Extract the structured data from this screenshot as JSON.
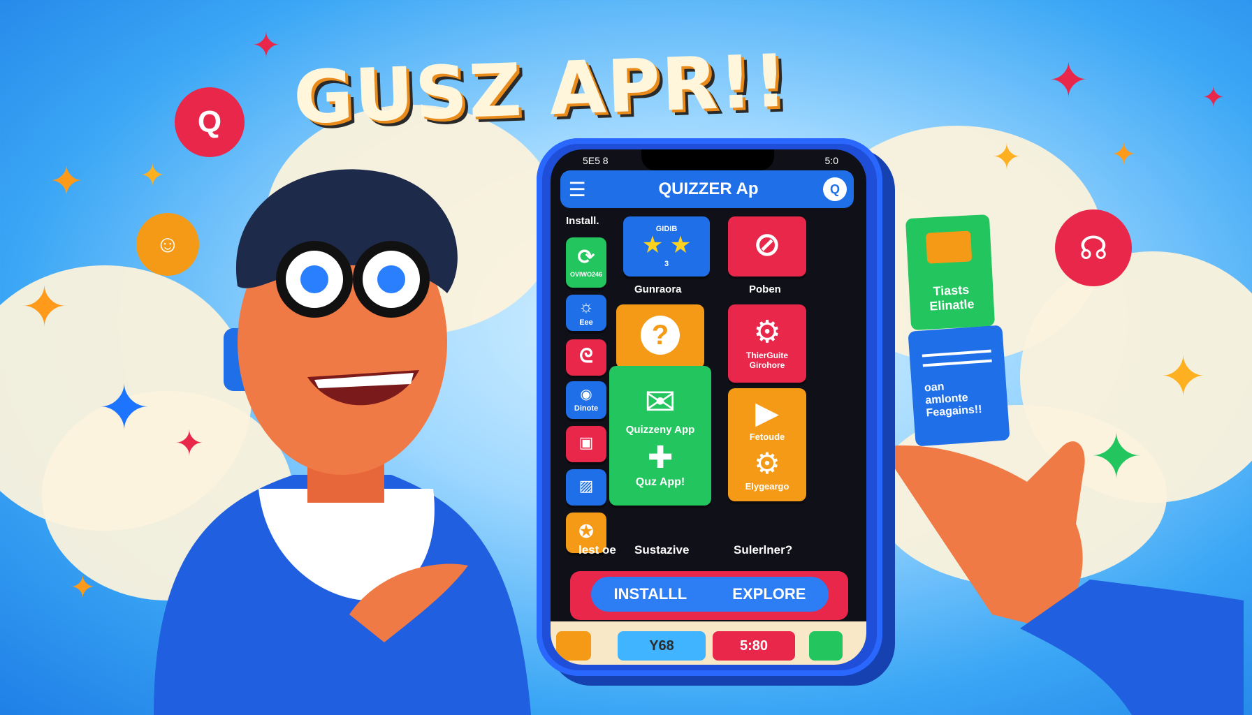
{
  "headline": "GUSZ APR!!",
  "colors": {
    "blue": "#1f6fe8",
    "green": "#22c55e",
    "orange": "#f59a16",
    "red": "#e8274a"
  },
  "phone": {
    "status_left": "5E5 8",
    "status_right": "5:0",
    "app_title": "QUIZZER Ap",
    "menu_icon": "hamburger-icon",
    "search_icon": "search-icon",
    "install_label": "Install.",
    "tiles": {
      "left_green_caption": "OVIWO246",
      "left_blue_caption": "Eee",
      "left_purple_caption": "Dinote",
      "stars_top": "GIDIB",
      "stars_count": "3",
      "stars_caption": "Gunraora",
      "ban_caption": "Poben",
      "green_big_caption": "Quizzeny App",
      "green_big_sub": "Quz App!",
      "red_gear_title": "ThierGuite",
      "red_gear_sub": "Girohore",
      "orange_play": "Fetoude",
      "orange_gear": "Elygeargo"
    },
    "row_labels": [
      "lest oe",
      "Sustazive",
      "Sulerlner?"
    ],
    "install_button": "INSTALLL",
    "explore_button": "EXPLORE",
    "pill_1": "Y68",
    "pill_2": "5:80"
  },
  "side": {
    "card_title_1": "Tiasts",
    "card_title_2": "Elinatle",
    "bubble_line_1": "oan",
    "bubble_line_2": "amlonte",
    "bubble_line_3": "Feagains!!"
  }
}
